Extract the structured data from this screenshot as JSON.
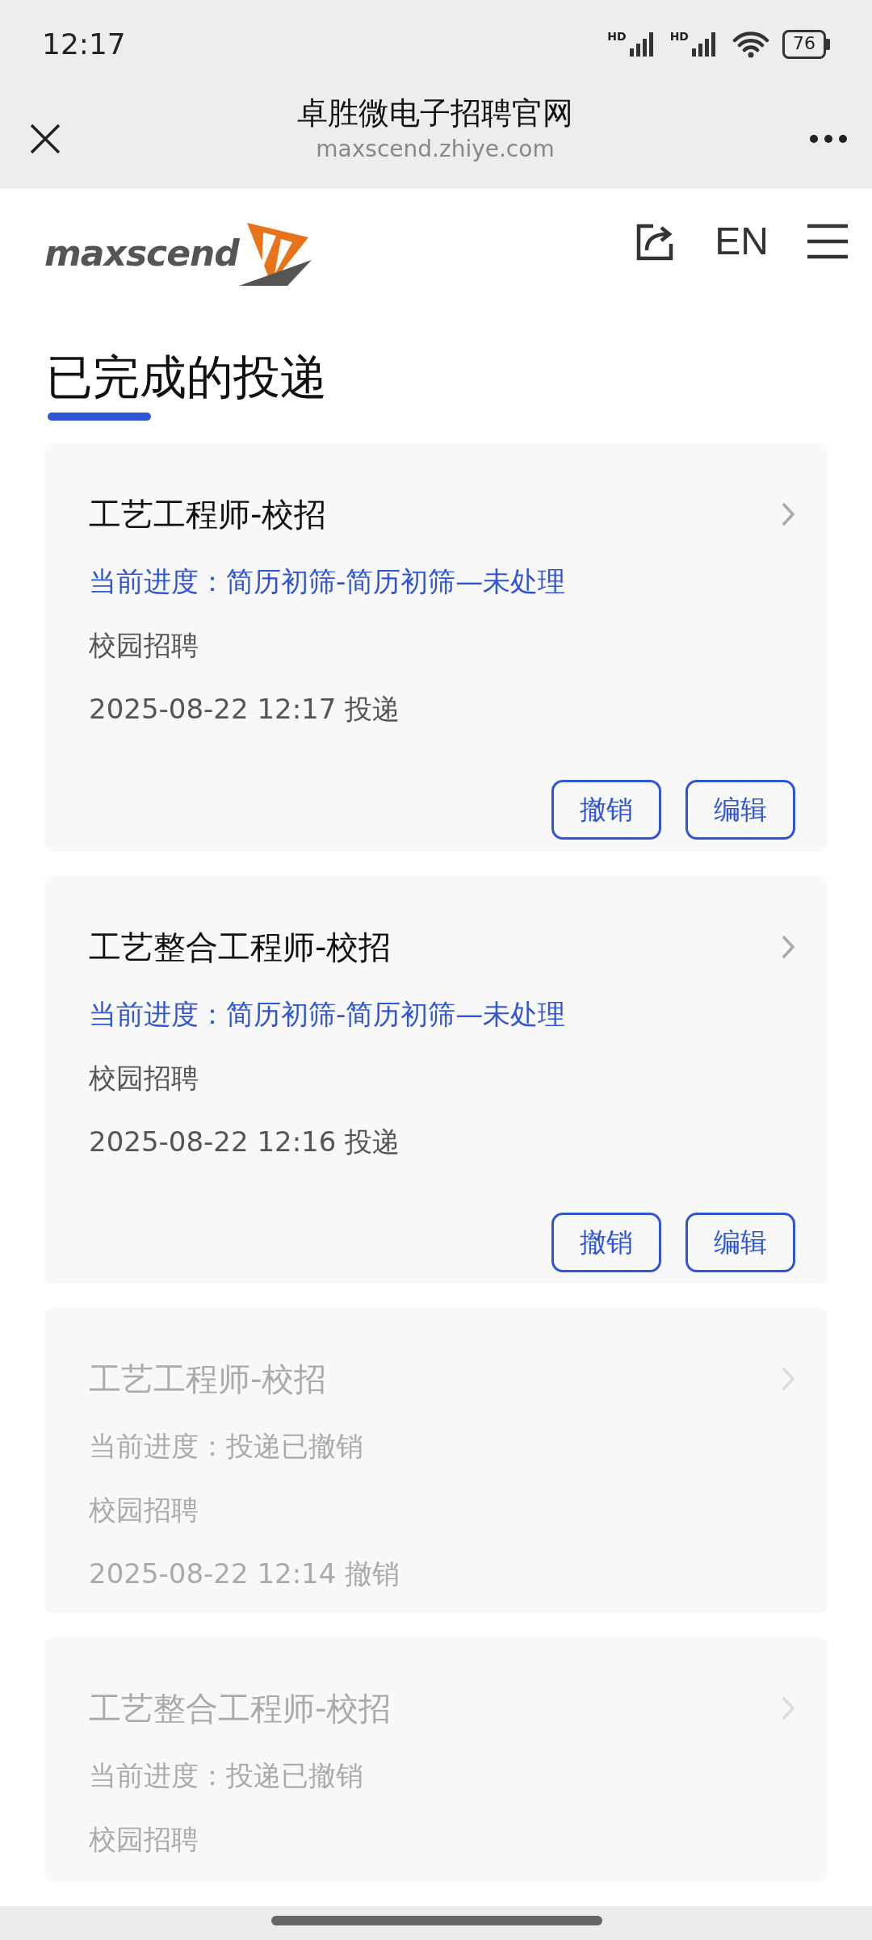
{
  "status_bar": {
    "time": "12:17",
    "networks": [
      "HD",
      "HD"
    ],
    "battery": "76"
  },
  "browser_bar": {
    "title": "卓胜微电子招聘官网",
    "url": "maxscend.zhiye.com"
  },
  "header": {
    "logo": "maxscend",
    "language": "EN"
  },
  "page_title": "已完成的投递",
  "applications": [
    {
      "title": "工艺工程师-校招",
      "progress": "当前进度：简历初筛-简历初筛—未处理",
      "category": "校园招聘",
      "time": "2025-08-22 12:17 投递",
      "withdrawn": false,
      "buttons": [
        "撤销",
        "编辑"
      ]
    },
    {
      "title": "工艺整合工程师-校招",
      "progress": "当前进度：简历初筛-简历初筛—未处理",
      "category": "校园招聘",
      "time": "2025-08-22 12:16 投递",
      "withdrawn": false,
      "buttons": [
        "撤销",
        "编辑"
      ]
    },
    {
      "title": "工艺工程师-校招",
      "progress": "当前进度：投递已撤销",
      "category": "校园招聘",
      "time": "2025-08-22 12:14 撤销",
      "withdrawn": true
    },
    {
      "title": "工艺整合工程师-校招",
      "progress": "当前进度：投递已撤销",
      "category": "校园招聘",
      "withdrawn": true
    }
  ]
}
